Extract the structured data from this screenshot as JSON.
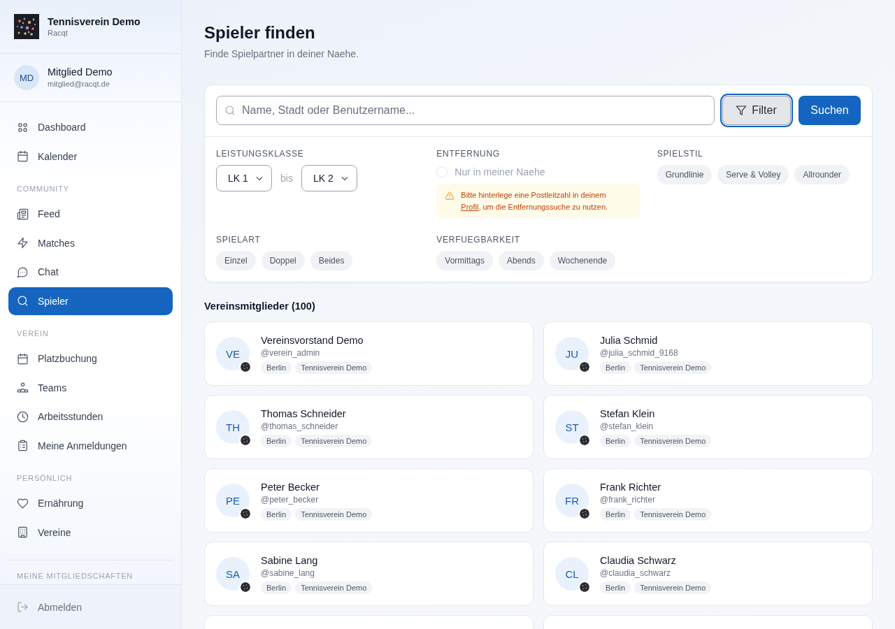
{
  "sidebar": {
    "club": {
      "name": "Tennisverein Demo",
      "subtitle": "Racqt"
    },
    "user": {
      "initials": "MD",
      "name": "Mitglied Demo",
      "email": "mitglied@racqt.de"
    },
    "nav": [
      {
        "items": [
          {
            "label": "Dashboard",
            "selected": false
          },
          {
            "label": "Kalender",
            "selected": false
          }
        ]
      },
      {
        "heading": "COMMUNITY",
        "items": [
          {
            "label": "Feed",
            "selected": false
          },
          {
            "label": "Matches",
            "selected": false
          },
          {
            "label": "Chat",
            "selected": false
          },
          {
            "label": "Spieler",
            "selected": true
          }
        ]
      },
      {
        "heading": "VEREIN",
        "items": [
          {
            "label": "Platzbuchung",
            "selected": false
          },
          {
            "label": "Teams",
            "selected": false
          },
          {
            "label": "Arbeitsstunden",
            "selected": false
          },
          {
            "label": "Meine Anmeldungen",
            "selected": false
          }
        ]
      },
      {
        "heading": "PERSÖNLICH",
        "items": [
          {
            "label": "Ernährung",
            "selected": false
          },
          {
            "label": "Vereine",
            "selected": false
          }
        ]
      }
    ],
    "memberships": {
      "heading": "MEINE MITGLIEDSCHAFTEN"
    },
    "logout": "Abmelden"
  },
  "page": {
    "title": "Spieler finden",
    "subtitle": "Finde Spielpartner in deiner Naehe."
  },
  "search": {
    "placeholder": "Name, Stadt oder Benutzername...",
    "filter_button": {
      "label": "Filter",
      "focused": true
    },
    "search_button": "Suchen"
  },
  "filters": [
    {
      "kind": "range",
      "heading": "LEISTUNGSKLASSE",
      "from": "LK 1",
      "separator": "bis",
      "to": "LK 2"
    },
    {
      "kind": "distance",
      "heading": "ENTFERNUNG",
      "option": {
        "label": "Nur in meiner Naehe",
        "checked": false,
        "disabled": true
      },
      "notice": {
        "before": "Bitte hinterlege eine Postleitzahl in deinem ",
        "link": "Profil",
        "after": ", um die Entfernungssuche zu nutzen."
      }
    },
    {
      "kind": "chips",
      "heading": "SPIELSTIL",
      "options": [
        {
          "label": "Grundlinie",
          "selected": false
        },
        {
          "label": "Serve & Volley",
          "selected": false
        },
        {
          "label": "Allrounder",
          "selected": false
        }
      ]
    },
    {
      "kind": "chips",
      "heading": "SPIELART",
      "options": [
        {
          "label": "Einzel",
          "selected": false
        },
        {
          "label": "Doppel",
          "selected": false
        },
        {
          "label": "Beides",
          "selected": false
        }
      ]
    },
    {
      "kind": "chips",
      "heading": "VERFUEGBARKEIT",
      "options": [
        {
          "label": "Vormittags",
          "selected": false
        },
        {
          "label": "Abends",
          "selected": false
        },
        {
          "label": "Wochenende",
          "selected": false
        }
      ]
    }
  ],
  "members": {
    "heading": "Vereinsmitglieder (100)",
    "list": [
      {
        "kind": "full",
        "initials": "VE",
        "name": "Vereinsvorstand Demo",
        "username": "@verein_admin",
        "tags": [
          "Berlin",
          "Tennisverein Demo"
        ]
      },
      {
        "kind": "full",
        "initials": "JU",
        "name": "Julia Schmid",
        "username": "@julia_schmid_9168",
        "tags": [
          "Berlin",
          "Tennisverein Demo"
        ]
      },
      {
        "kind": "full",
        "initials": "TH",
        "name": "Thomas Schneider",
        "username": "@thomas_schneider",
        "tags": [
          "Berlin",
          "Tennisverein Demo"
        ]
      },
      {
        "kind": "full",
        "initials": "ST",
        "name": "Stefan Klein",
        "username": "@stefan_klein",
        "tags": [
          "Berlin",
          "Tennisverein Demo"
        ]
      },
      {
        "kind": "full",
        "initials": "PE",
        "name": "Peter Becker",
        "username": "@peter_becker",
        "tags": [
          "Berlin",
          "Tennisverein Demo"
        ]
      },
      {
        "kind": "full",
        "initials": "FR",
        "name": "Frank Richter",
        "username": "@frank_richter",
        "tags": [
          "Berlin",
          "Tennisverein Demo"
        ]
      },
      {
        "kind": "full",
        "initials": "SA",
        "name": "Sabine Lang",
        "username": "@sabine_lang",
        "tags": [
          "Berlin",
          "Tennisverein Demo"
        ]
      },
      {
        "kind": "full",
        "initials": "CL",
        "name": "Claudia Schwarz",
        "username": "@claudia_schwarz",
        "tags": [
          "Berlin",
          "Tennisverein Demo"
        ]
      },
      {
        "kind": "partial"
      },
      {
        "kind": "partial"
      }
    ]
  }
}
